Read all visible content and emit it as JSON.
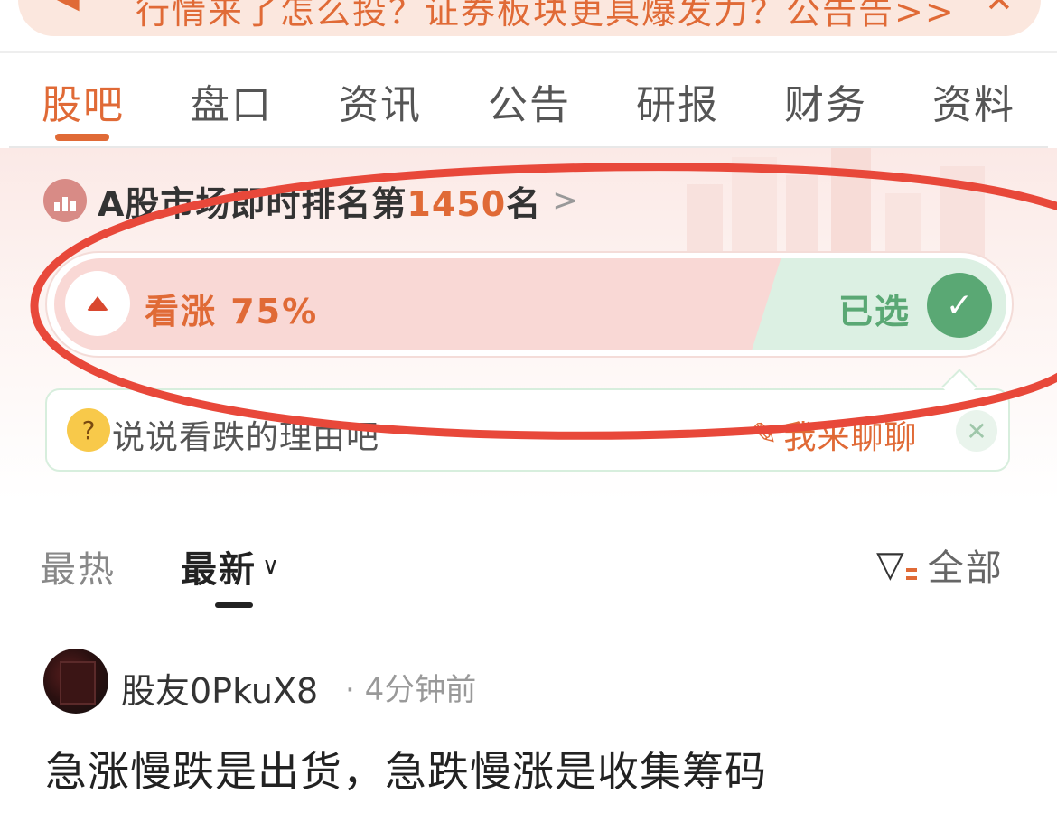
{
  "banner": {
    "text": "行情来了怎么投？证券板块更具爆发力？公告告>>",
    "icon": "megaphone-icon",
    "close": "✕"
  },
  "tabs": [
    {
      "label": "股吧",
      "active": true
    },
    {
      "label": "盘口",
      "active": false
    },
    {
      "label": "资讯",
      "active": false
    },
    {
      "label": "公告",
      "active": false
    },
    {
      "label": "研报",
      "active": false
    },
    {
      "label": "财务",
      "active": false
    },
    {
      "label": "资料",
      "active": false
    }
  ],
  "rank": {
    "prefix": "A股市场即时排名第",
    "number": "1450",
    "suffix": "名",
    "chevron": ">"
  },
  "vote": {
    "bull_label": "看涨 75%",
    "bull_percent": 75,
    "selected_label": "已选",
    "check": "✓"
  },
  "chat": {
    "prompt": "说说看跌的理由吧",
    "action": "我来聊聊",
    "close": "✕"
  },
  "sort": {
    "hot": "最热",
    "new": "最新",
    "filter": "全部"
  },
  "post": {
    "username": "股友0PkuX8",
    "time": "· 4分钟前",
    "content": "急涨慢跌是出货，急跌慢涨是收集筹码"
  },
  "colors": {
    "accent": "#e06a36",
    "bull": "#f9d8d5",
    "bear": "#dcf0e3",
    "selected": "#5aa874",
    "annotation": "#e8483a"
  }
}
